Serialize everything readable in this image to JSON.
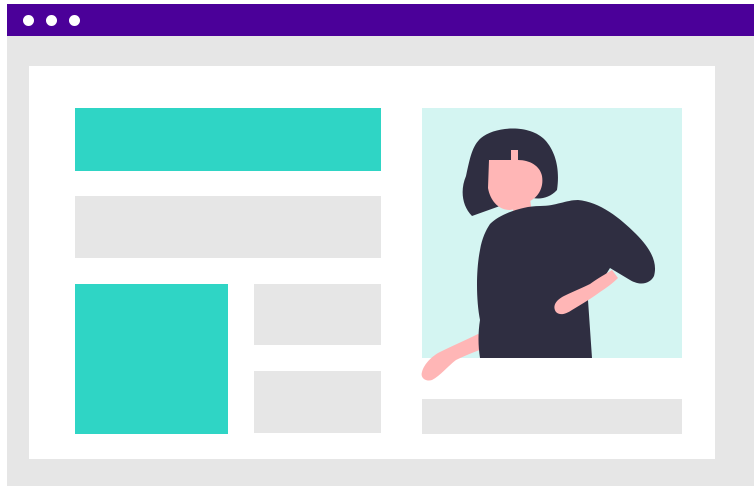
{
  "colors": {
    "title_bar": "#4b0099",
    "window_frame": "#e6e6e6",
    "page": "#ffffff",
    "accent_teal": "#2fd5c5",
    "placeholder_gray": "#e6e6e6",
    "photo_background": "#d4f5f2",
    "hair": "#2f2e41",
    "shirt": "#2f2e41",
    "skin": "#ffb6b6"
  },
  "icons": {
    "window_controls": [
      "window-dot-icon",
      "window-dot-icon",
      "window-dot-icon"
    ],
    "illustration": "woman-waving-illustration"
  }
}
